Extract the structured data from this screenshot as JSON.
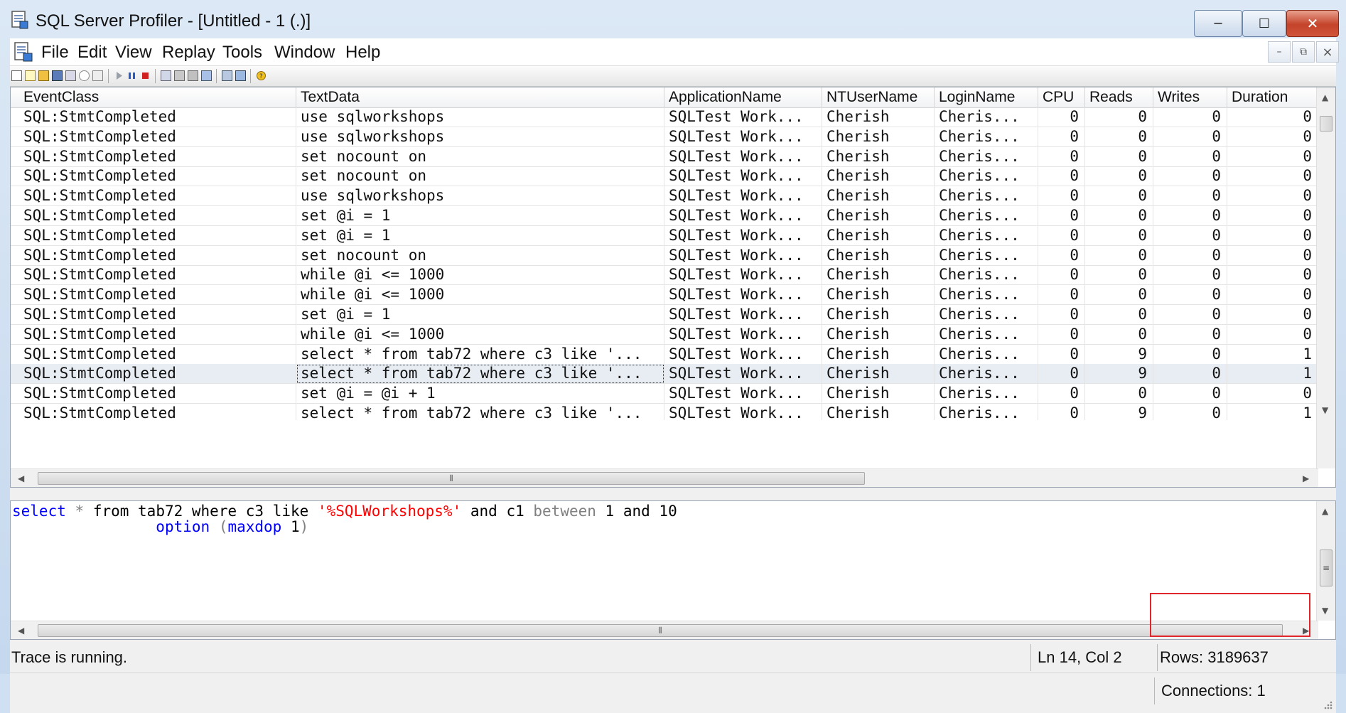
{
  "window": {
    "title": "SQL Server Profiler - [Untitled - 1 (.)]",
    "minimize_glyph": "─",
    "maximize_glyph": "☐",
    "close_glyph": "✕"
  },
  "menu": {
    "items": [
      "File",
      "Edit",
      "View",
      "Replay",
      "Tools",
      "Window",
      "Help"
    ],
    "mdi_minimize": "–",
    "mdi_restore": "⧉",
    "mdi_close": "×"
  },
  "grid": {
    "columns": [
      "EventClass",
      "TextData",
      "ApplicationName",
      "NTUserName",
      "LoginName",
      "CPU",
      "Reads",
      "Writes",
      "Duration"
    ],
    "rows": [
      [
        "SQL:StmtCompleted",
        "use sqlworkshops",
        "SQLTest Work...",
        "Cherish",
        "Cheris...",
        "0",
        "0",
        "0",
        "0"
      ],
      [
        "SQL:StmtCompleted",
        "use sqlworkshops",
        "SQLTest Work...",
        "Cherish",
        "Cheris...",
        "0",
        "0",
        "0",
        "0"
      ],
      [
        "SQL:StmtCompleted",
        "set nocount on",
        "SQLTest Work...",
        "Cherish",
        "Cheris...",
        "0",
        "0",
        "0",
        "0"
      ],
      [
        "SQL:StmtCompleted",
        "set nocount on",
        "SQLTest Work...",
        "Cherish",
        "Cheris...",
        "0",
        "0",
        "0",
        "0"
      ],
      [
        "SQL:StmtCompleted",
        "use sqlworkshops",
        "SQLTest Work...",
        "Cherish",
        "Cheris...",
        "0",
        "0",
        "0",
        "0"
      ],
      [
        "SQL:StmtCompleted",
        "set @i = 1",
        "SQLTest Work...",
        "Cherish",
        "Cheris...",
        "0",
        "0",
        "0",
        "0"
      ],
      [
        "SQL:StmtCompleted",
        "set @i = 1",
        "SQLTest Work...",
        "Cherish",
        "Cheris...",
        "0",
        "0",
        "0",
        "0"
      ],
      [
        "SQL:StmtCompleted",
        "set nocount on",
        "SQLTest Work...",
        "Cherish",
        "Cheris...",
        "0",
        "0",
        "0",
        "0"
      ],
      [
        "SQL:StmtCompleted",
        "while @i <= 1000",
        "SQLTest Work...",
        "Cherish",
        "Cheris...",
        "0",
        "0",
        "0",
        "0"
      ],
      [
        "SQL:StmtCompleted",
        "while @i <= 1000",
        "SQLTest Work...",
        "Cherish",
        "Cheris...",
        "0",
        "0",
        "0",
        "0"
      ],
      [
        "SQL:StmtCompleted",
        "set @i = 1",
        "SQLTest Work...",
        "Cherish",
        "Cheris...",
        "0",
        "0",
        "0",
        "0"
      ],
      [
        "SQL:StmtCompleted",
        "while @i <= 1000",
        "SQLTest Work...",
        "Cherish",
        "Cheris...",
        "0",
        "0",
        "0",
        "0"
      ],
      [
        "SQL:StmtCompleted",
        "select * from tab72 where c3 like '...",
        "SQLTest Work...",
        "Cherish",
        "Cheris...",
        "0",
        "9",
        "0",
        "1"
      ],
      [
        "SQL:StmtCompleted",
        "select * from tab72 where c3 like '...",
        "SQLTest Work...",
        "Cherish",
        "Cheris...",
        "0",
        "9",
        "0",
        "1"
      ],
      [
        "SQL:StmtCompleted",
        "set @i = @i + 1",
        "SQLTest Work...",
        "Cherish",
        "Cheris...",
        "0",
        "0",
        "0",
        "0"
      ],
      [
        "SQL:StmtCompleted",
        "select * from tab72 where c3 like '...",
        "SQLTest Work...",
        "Cherish",
        "Cheris...",
        "0",
        "9",
        "0",
        "1"
      ]
    ],
    "selected_row": 13,
    "scroll_glyphs": {
      "up": "▲",
      "down": "▼",
      "left": "◀",
      "right": "▶",
      "grip_h": "⦀",
      "grip_v": "≡"
    }
  },
  "sql_text": {
    "line1": [
      {
        "t": "select",
        "c": "kw"
      },
      {
        "t": " ",
        "c": "txt"
      },
      {
        "t": "*",
        "c": "gray"
      },
      {
        "t": " from tab72 where c3 ",
        "c": "txt"
      },
      {
        "t": "like",
        "c": "txt"
      },
      {
        "t": " ",
        "c": "txt"
      },
      {
        "t": "'%SQLWorkshops%'",
        "c": "str"
      },
      {
        "t": " ",
        "c": "txt"
      },
      {
        "t": "and",
        "c": "txt"
      },
      {
        "t": " c1 ",
        "c": "txt"
      },
      {
        "t": "between",
        "c": "gray"
      },
      {
        "t": " 1 ",
        "c": "txt"
      },
      {
        "t": "and",
        "c": "txt"
      },
      {
        "t": " 10",
        "c": "txt"
      }
    ],
    "line2": [
      {
        "t": "                ",
        "c": "txt"
      },
      {
        "t": "option",
        "c": "kw"
      },
      {
        "t": " ",
        "c": "txt"
      },
      {
        "t": "(",
        "c": "gray"
      },
      {
        "t": "maxdop",
        "c": "kw"
      },
      {
        "t": " 1",
        "c": "txt"
      },
      {
        "t": ")",
        "c": "gray"
      }
    ]
  },
  "status": {
    "message": "Trace is running.",
    "position": "Ln 14, Col 2",
    "rows": "Rows: 3189637",
    "connections": "Connections: 1"
  },
  "colors": {
    "keyword": "#0000ff",
    "string": "#ff0000",
    "operator": "#808080",
    "highlight_box": "#e0262b"
  }
}
